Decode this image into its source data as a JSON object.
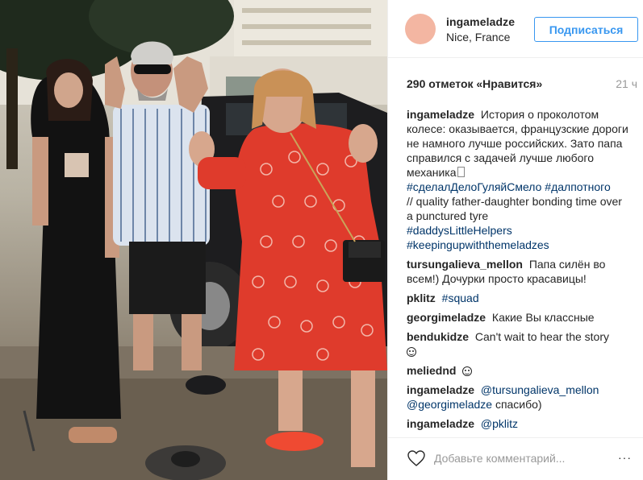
{
  "post": {
    "username": "ingameladze",
    "location": "Nice, France",
    "follow_label": "Подписаться",
    "likes_text": "290 отметок «Нравится»",
    "time_ago": "21 ч"
  },
  "caption": {
    "user": "ingameladze",
    "text": "История о проколотом колесе: оказывается, французские дороги не намного лучше российских. Зато папа справился с задачей лучше любого механика",
    "tags1": "#сделалДелоГуляйСмело #далпотного",
    "text2": "// quality father-daughter bonding time over a punctured tyre",
    "tag2": "#daddysLittleHelpers",
    "tag3": "#keepingupwiththemeladzes"
  },
  "comments": [
    {
      "user": "tursungalieva_mellon",
      "text": "Папа силён во всем!) Дочурки просто красавицы!"
    },
    {
      "user": "pklitz",
      "text": "#squad"
    },
    {
      "user": "georgimeladze",
      "text": "Какие Вы классные"
    },
    {
      "user": "bendukidze",
      "text": "Can't wait to hear the story"
    },
    {
      "user": "meliednd",
      "text": ""
    },
    {
      "user": "ingameladze",
      "mention1": "@tursungalieva_mellon",
      "mention2": "@georgimeladze",
      "text": "спасибо)"
    },
    {
      "user": "ingameladze",
      "mention1": "@pklitz",
      "text": ""
    }
  ],
  "footer": {
    "comment_placeholder": "Добавьте комментарий...",
    "more_label": "···"
  },
  "icons": {
    "heart": "heart-icon",
    "more": "more-options-icon",
    "laugh": "grinning-face-icon",
    "smile": "smiling-face-icon"
  },
  "colors": {
    "accent": "#3897f0",
    "hashtag": "#003569",
    "muted": "#999999",
    "avatar": "#f3b6a2"
  }
}
